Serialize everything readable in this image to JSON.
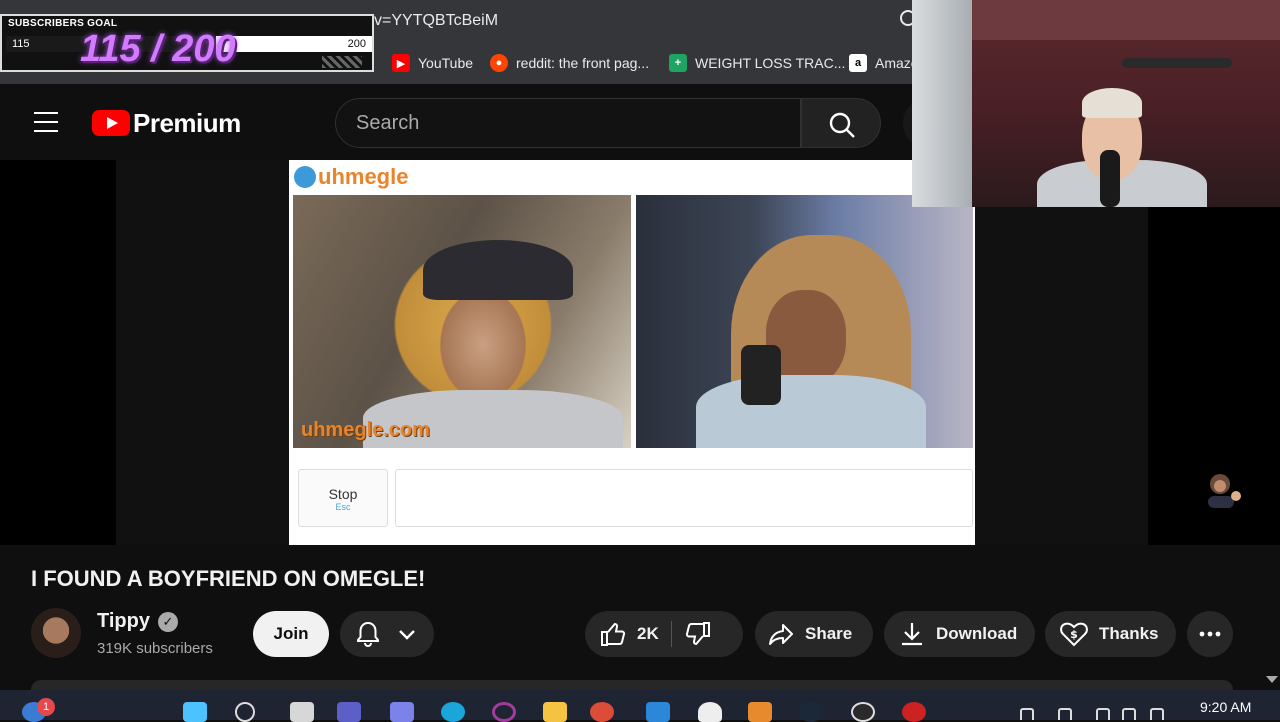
{
  "browser": {
    "url_fragment": "v=YYTQBTcBeiM",
    "bookmarks": [
      {
        "label": "YouTube",
        "icon": "youtube-icon",
        "color": "#ff0000"
      },
      {
        "label": "reddit: the front pag...",
        "icon": "reddit-icon",
        "color": "#ff4500"
      },
      {
        "label": "WEIGHT LOSS TRAC...",
        "icon": "sheets-icon",
        "color": "#1fa463"
      },
      {
        "label": "Amazo",
        "icon": "amazon-icon",
        "color": "#ffffff"
      }
    ]
  },
  "overlay": {
    "subgoal_label": "SUBSCRIBERS GOAL",
    "current": "115",
    "target": "200",
    "display": "115 / 200",
    "progress": 0.575,
    "accent": "#d27bff"
  },
  "youtube": {
    "logo_text": "Premium",
    "search_placeholder": "Search",
    "video_title": "I FOUND A BOYFRIEND ON OMEGLE!",
    "channel": {
      "name": "Tippy",
      "subscribers": "319K subscribers"
    },
    "actions": {
      "join": "Join",
      "likes": "2K",
      "share": "Share",
      "download": "Download",
      "thanks": "Thanks"
    }
  },
  "embedded": {
    "site_name": "uhmegle",
    "watermark": "uhmegle.com",
    "stop_label": "Stop",
    "stop_hint": "Esc"
  },
  "taskbar": {
    "notification_count": "1",
    "time": "9:20 AM"
  }
}
